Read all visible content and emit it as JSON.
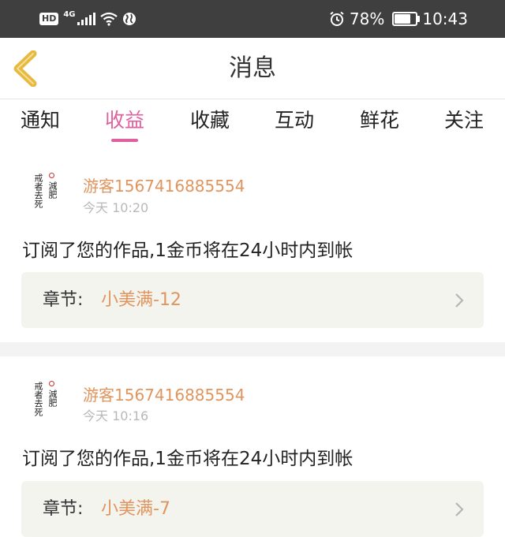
{
  "status_bar": {
    "hd": "HD",
    "network": "4G",
    "battery_percent": "78%",
    "battery_level": 0.78,
    "time": "10:43"
  },
  "header": {
    "title": "消息"
  },
  "tabs": [
    {
      "label": "通知",
      "active": false
    },
    {
      "label": "收益",
      "active": true
    },
    {
      "label": "收藏",
      "active": false
    },
    {
      "label": "互动",
      "active": false
    },
    {
      "label": "鲜花",
      "active": false
    },
    {
      "label": "关注",
      "active": false
    }
  ],
  "colors": {
    "accent_pink": "#e0609e",
    "orange_text": "#e0955e",
    "status_bar": "#3f3f3f",
    "chapter_bg": "#f4f4ef"
  },
  "messages": [
    {
      "username": "游客1567416885554",
      "time": "今天 10:20",
      "text": "订阅了您的作品,1金币将在24小时内到帐",
      "chapter_label": "章节:",
      "chapter_name": "小美满-12"
    },
    {
      "username": "游客1567416885554",
      "time": "今天 10:16",
      "text": "订阅了您的作品,1金币将在24小时内到帐",
      "chapter_label": "章节:",
      "chapter_name": "小美满-7"
    }
  ],
  "avatar_text": {
    "main": "戒者去死",
    "side": "減肥"
  }
}
